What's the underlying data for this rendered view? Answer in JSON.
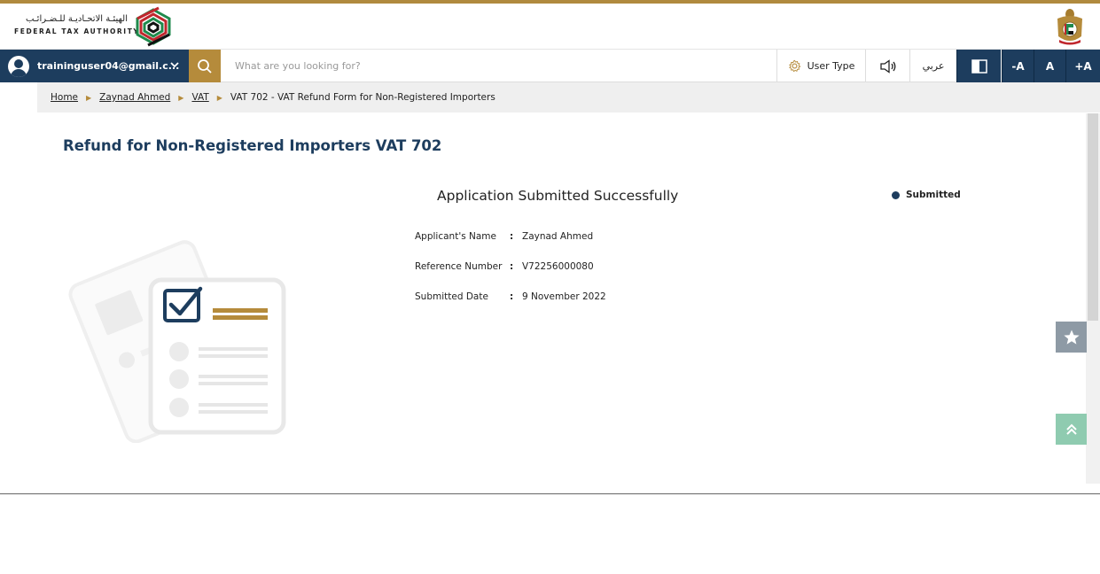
{
  "header": {
    "logo_ar": "الهيئـة الاتحـاديـة للـضـرائـب",
    "logo_en": "FEDERAL TAX AUTHORITY",
    "logo_icon": "fta-logo-icon",
    "emblem_icon": "uae-emblem-icon"
  },
  "toolbar": {
    "user_email": "traininguser04@gmail.c...",
    "search_placeholder": "What are you looking for?",
    "user_type_label": "User Type",
    "arabic_label": "عربي",
    "font_decrease": "-A",
    "font_normal": "A",
    "font_increase": "+A"
  },
  "breadcrumb": {
    "home": "Home",
    "user": "Zaynad Ahmed",
    "vat": "VAT",
    "current": "VAT 702 - VAT Refund Form for Non-Registered Importers",
    "separator": "▶"
  },
  "main": {
    "page_title": "Refund for Non-Registered Importers VAT 702",
    "success_title": "Application Submitted Successfully",
    "status_label": "Submitted",
    "details": [
      {
        "label": "Applicant's Name",
        "colon": ":",
        "value": "Zaynad Ahmed"
      },
      {
        "label": "Reference Number",
        "colon": ":",
        "value": "V72256000080"
      },
      {
        "label": "Submitted Date",
        "colon": ":",
        "value": "9 November 2022"
      }
    ]
  },
  "colors": {
    "navy": "#1d3d5e",
    "gold": "#b58b3b",
    "favorite_bg": "#8e9aa5",
    "scroll_top_bg": "#8fcbb0"
  }
}
